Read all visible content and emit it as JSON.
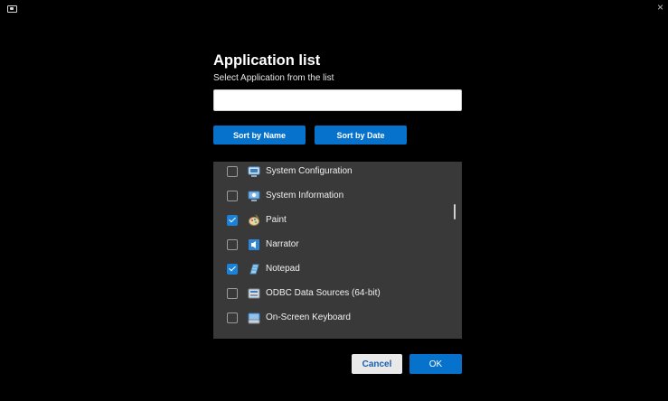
{
  "window": {
    "app_icon": "screen-icon",
    "close_icon": "close-icon",
    "close_glyph": "×"
  },
  "dialog": {
    "title": "Application list",
    "subtitle": "Select Application from the list",
    "search": {
      "value": "",
      "placeholder": ""
    },
    "sort_by_name_label": "Sort by Name",
    "sort_by_date_label": "Sort by Date",
    "cancel_label": "Cancel",
    "ok_label": "OK"
  },
  "apps": [
    {
      "label": "System Configuration",
      "checked": false,
      "icon": "system-configuration-icon"
    },
    {
      "label": "System Information",
      "checked": false,
      "icon": "system-information-icon"
    },
    {
      "label": "Paint",
      "checked": true,
      "icon": "paint-icon"
    },
    {
      "label": "Narrator",
      "checked": false,
      "icon": "narrator-icon"
    },
    {
      "label": "Notepad",
      "checked": true,
      "icon": "notepad-icon"
    },
    {
      "label": "ODBC Data Sources (64-bit)",
      "checked": false,
      "icon": "odbc-data-sources-icon"
    },
    {
      "label": "On-Screen Keyboard",
      "checked": false,
      "icon": "on-screen-keyboard-icon"
    }
  ],
  "colors": {
    "accent": "#0672cb",
    "check": "#1a82d9",
    "list_bg": "#393939",
    "background": "#000000"
  }
}
